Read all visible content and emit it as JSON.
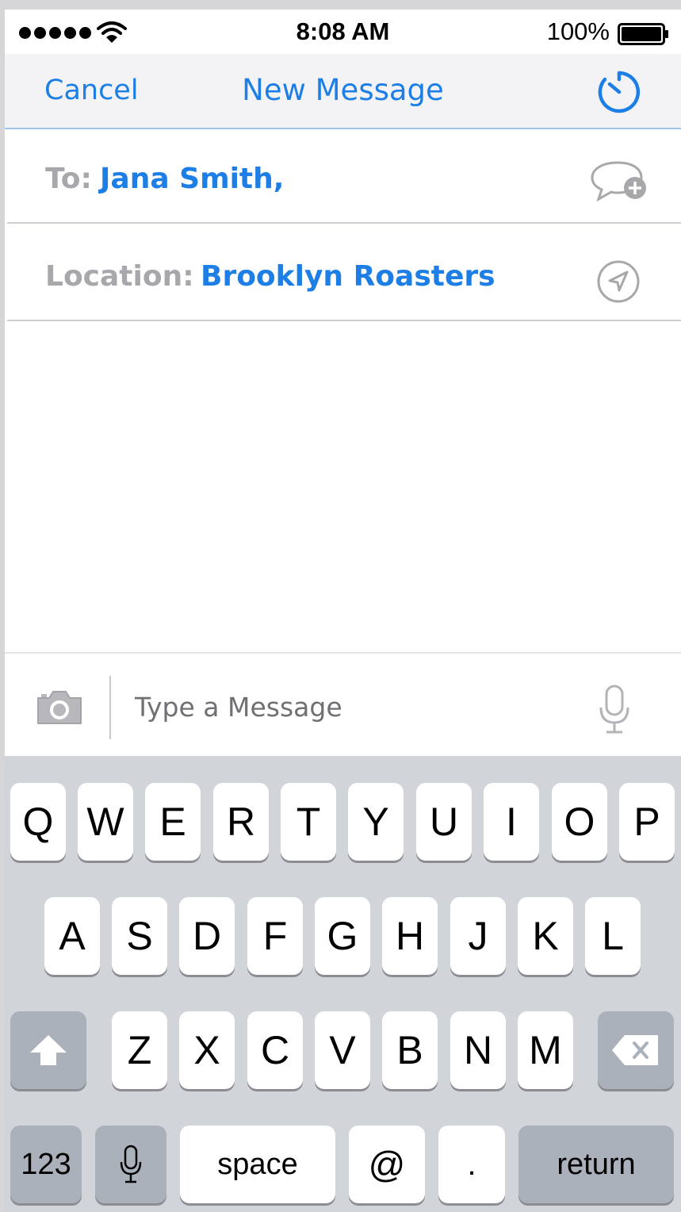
{
  "status_bar": {
    "time": "8:08 AM",
    "battery": "100%"
  },
  "nav": {
    "cancel_label": "Cancel",
    "title": "New Message",
    "timer_icon": "timer-icon"
  },
  "fields": {
    "to_label": "To:",
    "to_value": "Jana Smith,",
    "location_label": "Location:",
    "location_value": "Brooklyn Roasters"
  },
  "compose": {
    "placeholder": "Type a Message"
  },
  "keyboard": {
    "row1": [
      "Q",
      "W",
      "E",
      "R",
      "T",
      "Y",
      "U",
      "I",
      "O",
      "P"
    ],
    "row2": [
      "A",
      "S",
      "D",
      "F",
      "G",
      "H",
      "J",
      "K",
      "L"
    ],
    "row3": [
      "Z",
      "X",
      "C",
      "V",
      "B",
      "N",
      "M"
    ],
    "numbers_label": "123",
    "space_label": "space",
    "at_label": "@",
    "period_label": ".",
    "return_label": "return"
  },
  "colors": {
    "accent": "#1d7fe6",
    "label_gray": "#a8a8ac",
    "keyboard_bg": "#d1d4d9",
    "dark_key": "#abb1ba"
  }
}
